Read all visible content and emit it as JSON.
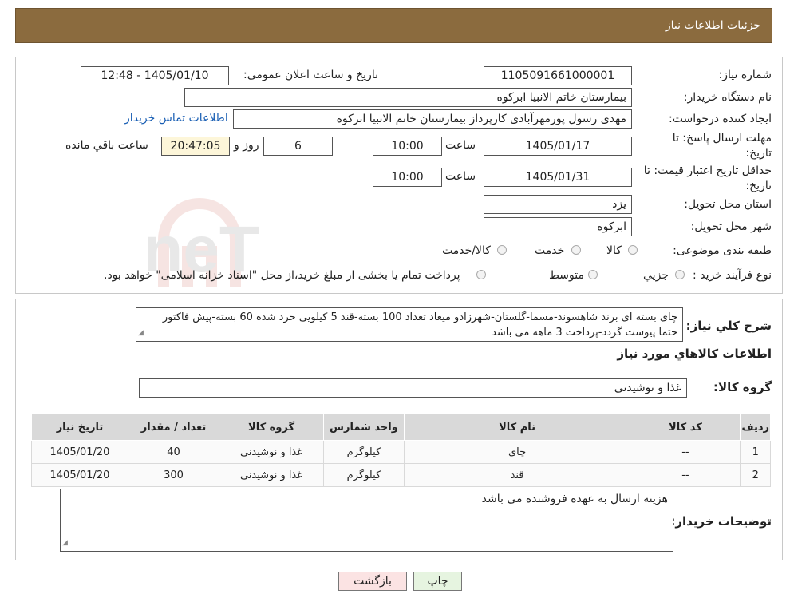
{
  "header": {
    "title": "جزئیات اطلاعات نیاز"
  },
  "fields": {
    "need_number_label": "شماره نیاز:",
    "need_number": "1105091661000001",
    "announce_label": "تاریخ و ساعت اعلان عمومی:",
    "announce_value": "1405/01/10 - 12:48",
    "buyer_org_label": "نام دستگاه خریدار:",
    "buyer_org": "بیمارستان خاتم الانبیا ابرکوه",
    "requester_label": "ایجاد کننده درخواست:",
    "requester": "مهدی رسول پورمهرآبادی کارپرداز بیمارستان خاتم الانبیا ابرکوه",
    "contact_link": "اطلاعات تماس خریدار",
    "deadline_label_1": "مهلت ارسال پاسخ: تا",
    "deadline_label_2": "تاریخ:",
    "deadline_date": "1405/01/17",
    "time_label": "ساعت",
    "deadline_time": "10:00",
    "days_value": "6",
    "days_label": "روز و",
    "remaining_time": "20:47:05",
    "remaining_label": "ساعت باقي مانده",
    "validity_label_1": "حداقل تاریخ اعتبار قیمت: تا",
    "validity_label_2": "تاریخ:",
    "validity_date": "1405/01/31",
    "validity_time": "10:00",
    "province_label": "استان محل تحویل:",
    "province": "یزد",
    "city_label": "شهر محل تحویل:",
    "city": "ابرکوه",
    "category_label": "طبقه بندی موضوعی:",
    "category_options": [
      "کالا",
      "خدمت",
      "کالا/خدمت"
    ],
    "process_label": "نوع فرآیند خرید :",
    "process_options": [
      "جزیي",
      "متوسط"
    ],
    "process_note": "پرداخت تمام یا بخشی از مبلغ خرید،از محل \"اسناد خزانه اسلامی\" خواهد بود."
  },
  "summary": {
    "label": "شرح کلي نياز:",
    "text": "چای بسته ای برند شاهسوند-مسما-گلستان-شهرزادو میعاد تعداد 100 بسته-قند 5 کیلویی خرد شده 60 بسته-پیش فاکتور حتما پیوست گردد-پرداخت 3 ماهه می باشد"
  },
  "goods_section_title": "اطلاعات کالاهاي مورد نياز",
  "goods_group": {
    "label": "گروه کالا:",
    "value": "غذا و نوشیدنی"
  },
  "table": {
    "headers": [
      "ردیف",
      "کد کالا",
      "نام کالا",
      "واحد شمارش",
      "گروه کالا",
      "تعداد / مقدار",
      "تاریخ نیاز"
    ],
    "rows": [
      [
        "1",
        "--",
        "چای",
        "کیلوگرم",
        "غذا و نوشیدنی",
        "40",
        "1405/01/20"
      ],
      [
        "2",
        "--",
        "قند",
        "کیلوگرم",
        "غذا و نوشیدنی",
        "300",
        "1405/01/20"
      ]
    ]
  },
  "buyer_notes": {
    "label": "توضیحات خریدار:",
    "text": "هزینه ارسال به عهده فروشنده می باشد"
  },
  "buttons": {
    "print": "چاپ",
    "back": "بازگشت"
  },
  "watermark_text": "AriaTender.neT"
}
